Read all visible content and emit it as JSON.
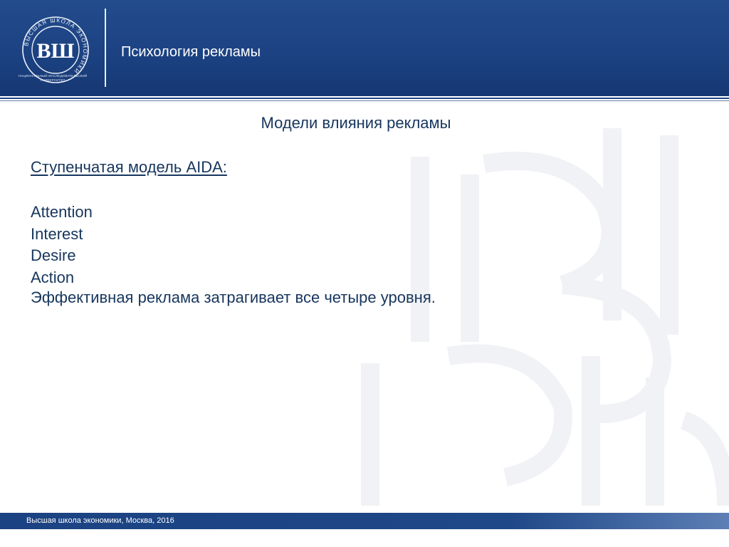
{
  "header": {
    "title": "Психология рекламы",
    "logo": {
      "ring_text": "ВЫСШАЯ ШКОЛА ЭКОНОМИКИ",
      "monogram": "ВШ",
      "caption_line1": "НАЦИОНАЛЬНЫЙ ИССЛЕДОВАТЕЛЬСКИЙ",
      "caption_line2": "УНИВЕРСИТЕТ"
    }
  },
  "slide": {
    "title": "Модели влияния рекламы",
    "model_heading": "Ступенчатая модель AIDA:",
    "stages": [
      "Attention",
      "Interest",
      "Desire",
      "Action"
    ],
    "conclusion": "Эффективная реклама затрагивает все четыре уровня."
  },
  "footer": {
    "text": "Высшая школа экономики, Москва, 2016"
  },
  "colors": {
    "brand_blue": "#1c4282",
    "text_navy": "#17365d",
    "header_text": "#ffffff"
  }
}
